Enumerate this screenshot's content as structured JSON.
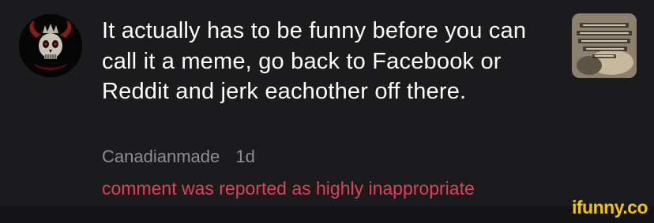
{
  "comment": {
    "text": "It actually has to be funny before you can call it a meme, go back to Facebook or Reddit and jerk eachother off there.",
    "username": "Canadianmade",
    "time_ago": "1d",
    "report_notice": "comment was reported as highly inappropriate",
    "avatar_icon": "horned-skull-avatar-icon",
    "thumbnail_icon": "meme-thumbnail-image"
  },
  "watermark": {
    "text": "ifunny.co",
    "color": "#f2c500"
  },
  "colors": {
    "background": "#1b1b1d",
    "comment_text": "#ffffff",
    "meta_text": "#8e8e93",
    "report_text": "#e0405a"
  }
}
